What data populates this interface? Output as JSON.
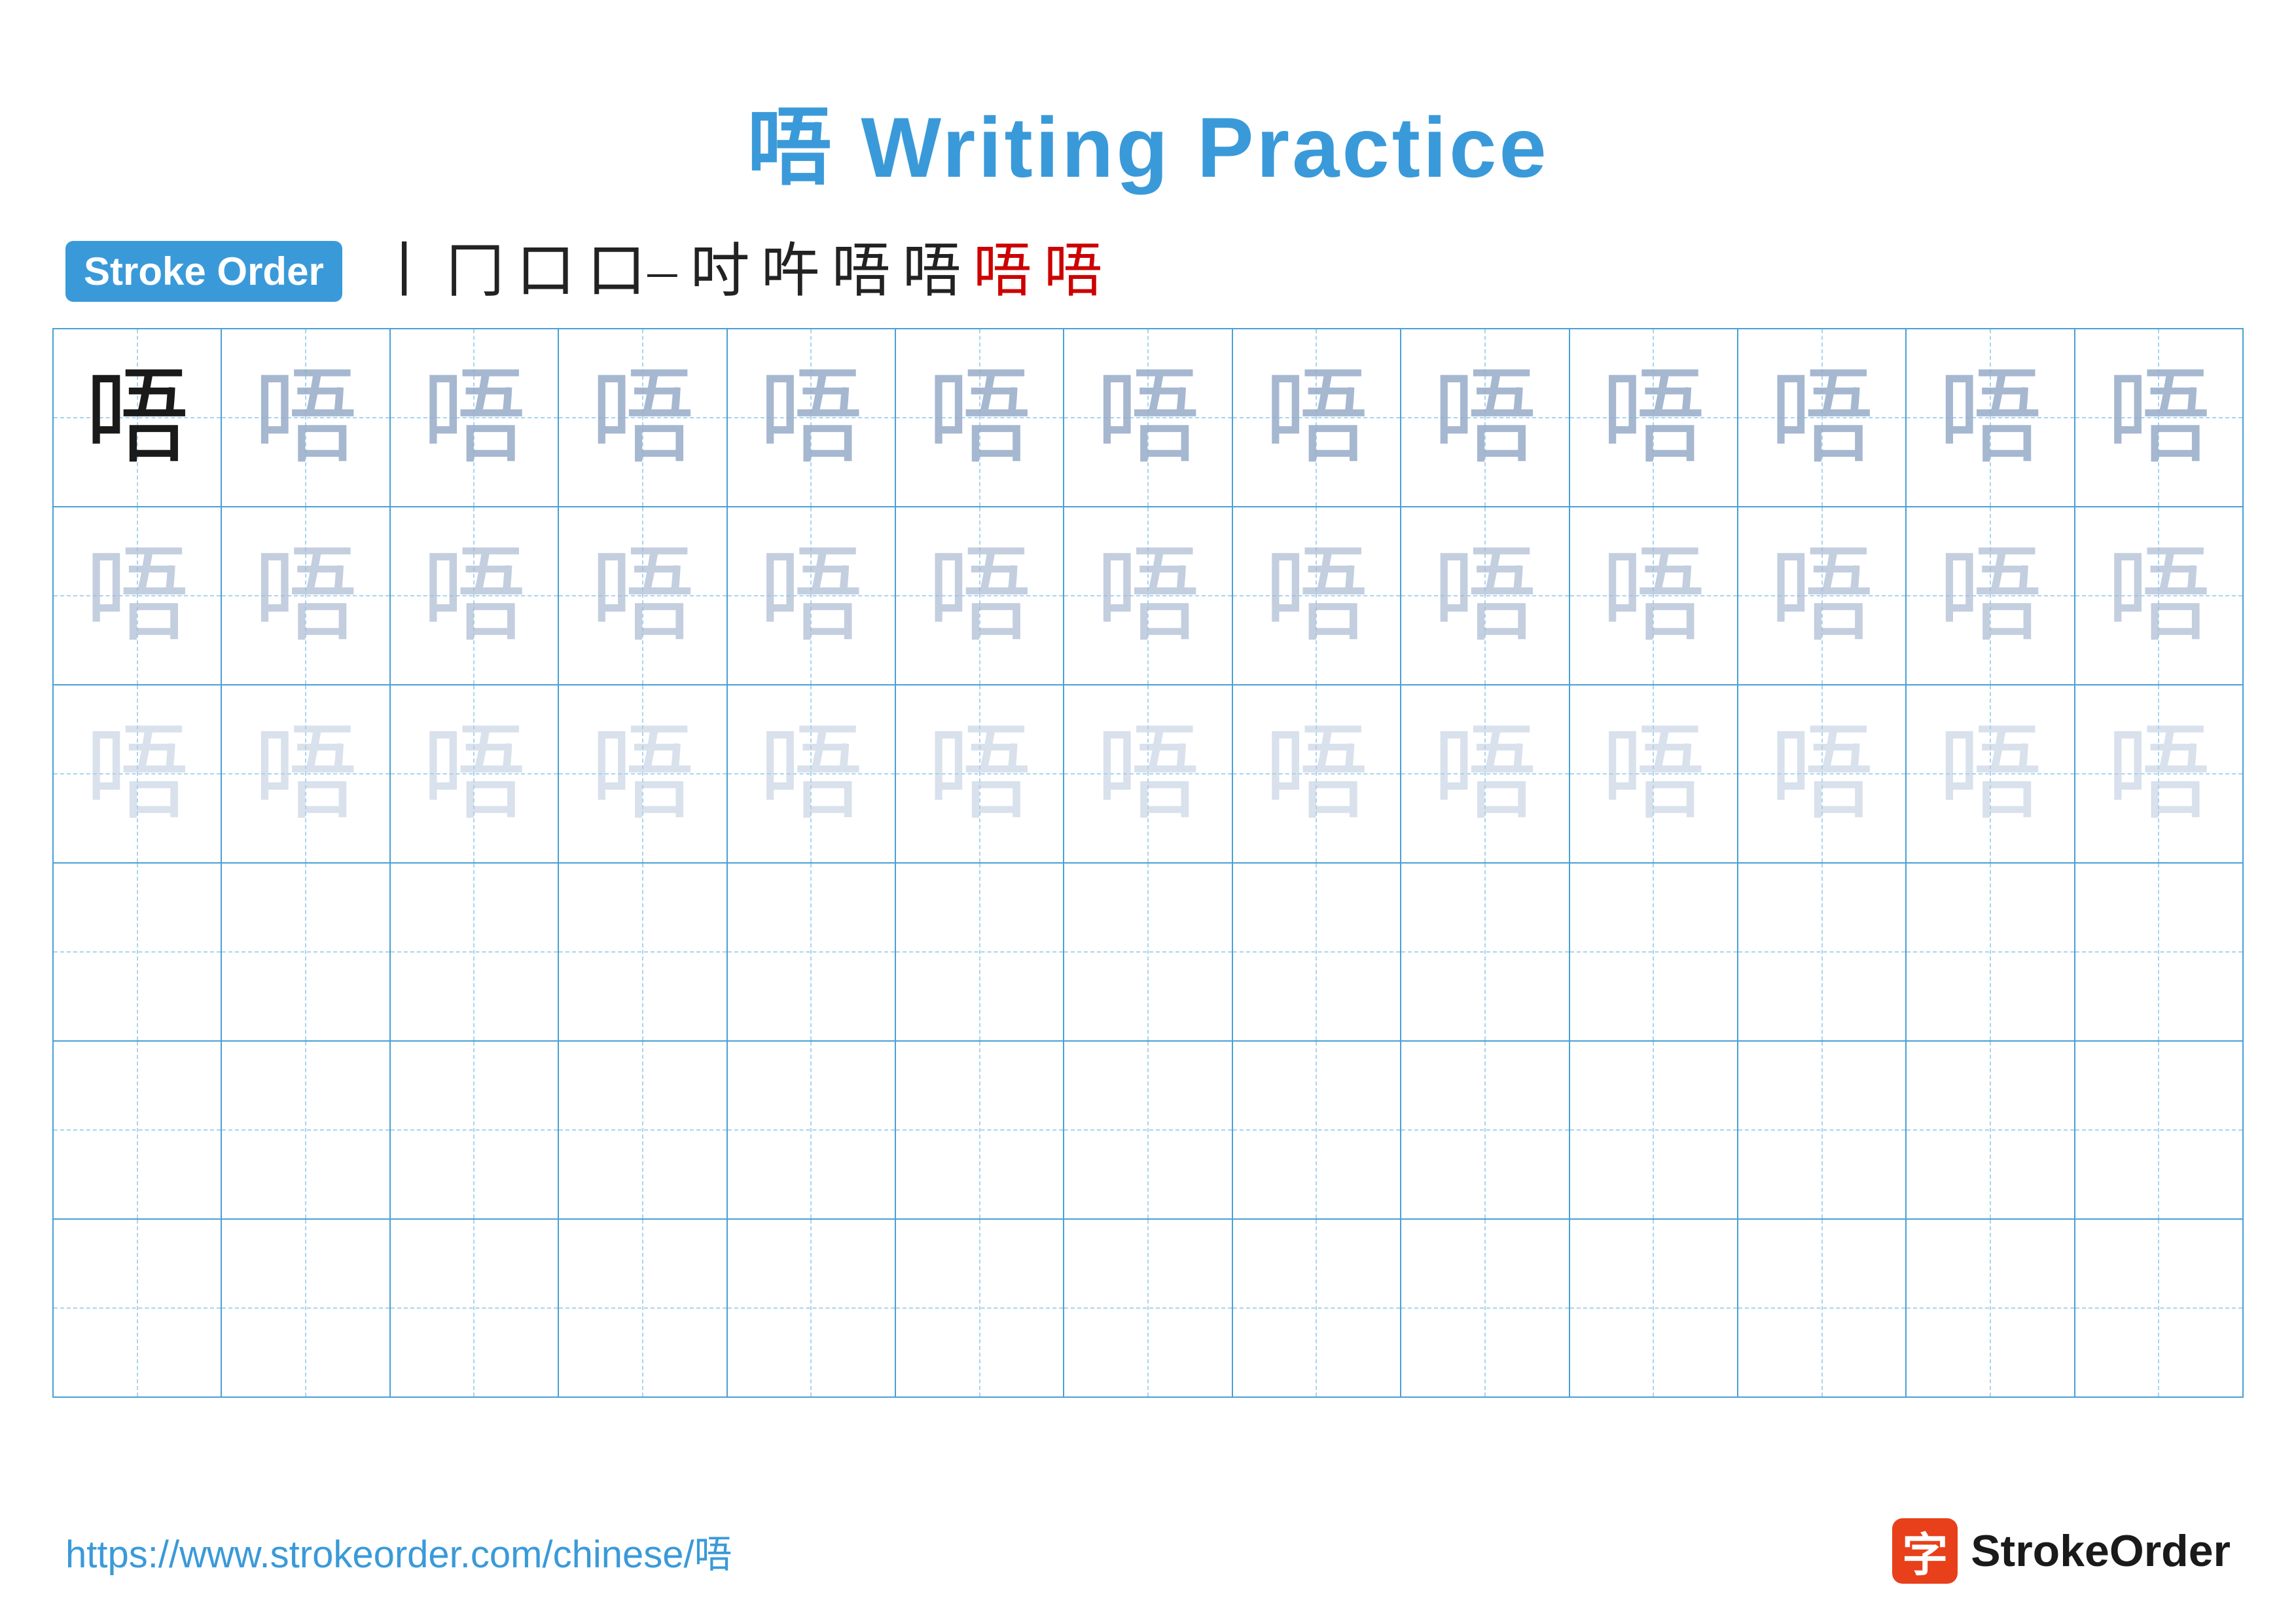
{
  "title": "唔 Writing Practice",
  "stroke_order": {
    "badge_label": "Stroke Order",
    "steps": [
      "丨",
      "冂",
      "口",
      "口一",
      "吋",
      "吘",
      "唔",
      "唔",
      "唔",
      "唔"
    ]
  },
  "grid": {
    "rows": 6,
    "cols": 13,
    "character": "唔"
  },
  "footer": {
    "url": "https://www.strokeorder.com/chinese/唔",
    "logo_char": "字",
    "logo_text": "StrokeOrder"
  }
}
